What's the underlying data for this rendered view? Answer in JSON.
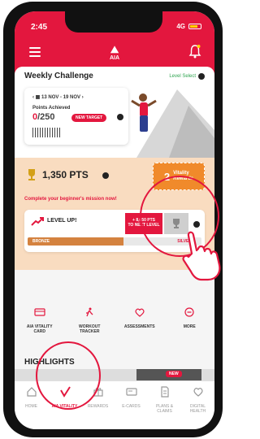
{
  "status_bar": {
    "time": "2:45",
    "signal": "4G"
  },
  "header": {
    "logo_text": "AIA",
    "menu_icon": "hamburger-icon",
    "notification_icon": "bell-icon"
  },
  "challenge": {
    "title": "Weekly Challenge",
    "level_select_label": "Level Select",
    "week_range": "13 NOV - 19 NOV",
    "points_label": "Points Achieved",
    "points_achieved": "0",
    "points_target": "/250",
    "new_target_label": "NEW TARGET"
  },
  "points": {
    "total": "1,350 PTS",
    "rewards_count": "2",
    "rewards_label_1": "Vitality",
    "rewards_label_2": "Rewards"
  },
  "mission": {
    "prompt": "Complete your beginner's mission now!"
  },
  "level_up": {
    "title": "LEVEL UP!",
    "points_to_next": "+ 8,650 PTS",
    "next_level_label": "TO NEXT LEVEL",
    "current_level": "BRONZE",
    "next_level": "SILVER",
    "progress_fraction": 0.55
  },
  "quick_actions": [
    {
      "label_1": "AIA VITALITY",
      "label_2": "CARD",
      "icon": "card-icon"
    },
    {
      "label_1": "WORKOUT",
      "label_2": "TRACKER",
      "icon": "running-icon"
    },
    {
      "label_1": "ASSESSMENTS",
      "label_2": "",
      "icon": "assessment-icon"
    },
    {
      "label_1": "MORE",
      "label_2": "",
      "icon": "more-icon"
    }
  ],
  "highlights": {
    "title": "HIGHLIGHTS",
    "new_tag": "NEW"
  },
  "bottom_nav": [
    {
      "label_1": "HOME",
      "label_2": "",
      "icon": "home-icon"
    },
    {
      "label_1": "AIA VITALITY",
      "label_2": "",
      "icon": "vitality-icon"
    },
    {
      "label_1": "REWARDS",
      "label_2": "",
      "icon": "gift-icon"
    },
    {
      "label_1": "E-CARDS",
      "label_2": "",
      "icon": "ecard-icon"
    },
    {
      "label_1": "PLANS &",
      "label_2": "CLAIMS",
      "icon": "document-icon"
    },
    {
      "label_1": "DIGITAL",
      "label_2": "HEALTH",
      "icon": "heart-icon"
    }
  ],
  "colors": {
    "brand_red": "#e3173e",
    "accent_orange": "#f08a2b",
    "card_peach": "#f9dcc0"
  }
}
